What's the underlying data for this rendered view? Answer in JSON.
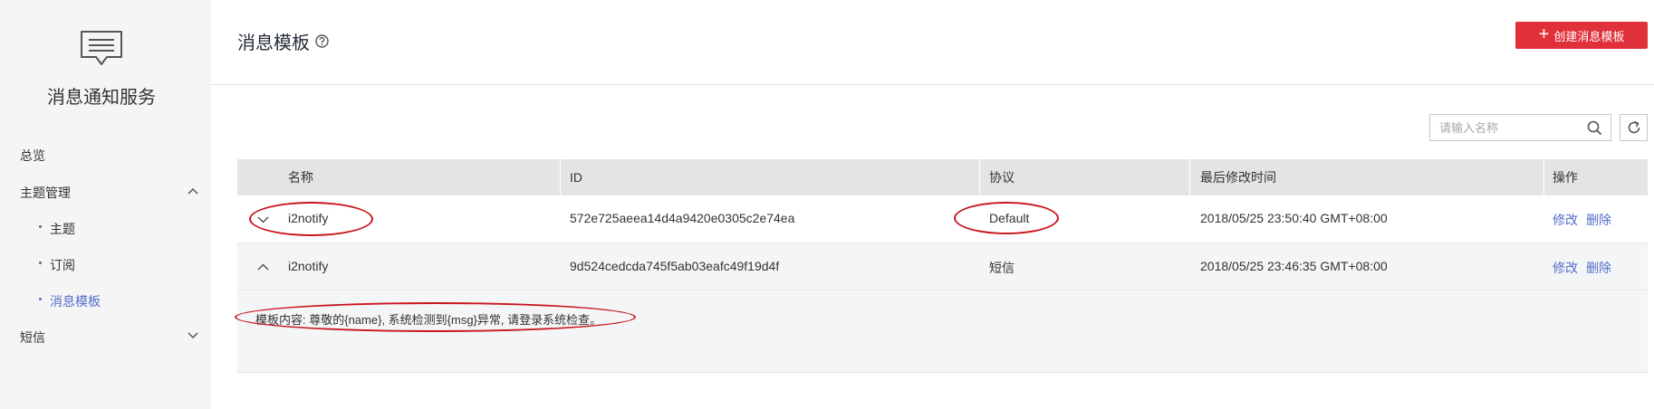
{
  "sidebar": {
    "service_title": "消息通知服务",
    "items": [
      {
        "label": "总览"
      },
      {
        "label": "主题管理",
        "expanded": true
      },
      {
        "label": "短信",
        "expanded": false
      }
    ],
    "sub_items": [
      {
        "label": "主题",
        "active": false
      },
      {
        "label": "订阅",
        "active": false
      },
      {
        "label": "消息模板",
        "active": true
      }
    ]
  },
  "header": {
    "title": "消息模板",
    "create_button": "创建消息模板"
  },
  "toolbar": {
    "search_placeholder": "请输入名称",
    "search_value": ""
  },
  "table": {
    "columns": [
      "名称",
      "ID",
      "协议",
      "最后修改时间",
      "操作"
    ],
    "rows": [
      {
        "name": "i2notify",
        "id": "572e725aeea14d4a9420e0305c2e74ea",
        "protocol": "Default",
        "modified": "2018/05/25 23:50:40 GMT+08:00",
        "actions": [
          "修改",
          "删除"
        ],
        "expanded": false
      },
      {
        "name": "i2notify",
        "id": "9d524cedcda745f5ab03eafc49f19d4f",
        "protocol": "短信",
        "modified": "2018/05/25 23:46:35 GMT+08:00",
        "actions": [
          "修改",
          "删除"
        ],
        "expanded": true
      }
    ],
    "expanded_detail": "模板内容: 尊敬的{name}, 系统检测到{msg}异常, 请登录系统检查。"
  },
  "colors": {
    "sidebar_bg": "#f5f5f5",
    "primary_red": "#e0303a",
    "link_blue": "#526ecc",
    "annotation_red": "#c8161d",
    "header_bg": "#e2e4e6",
    "expanded_bg": "#f4f5f6"
  }
}
